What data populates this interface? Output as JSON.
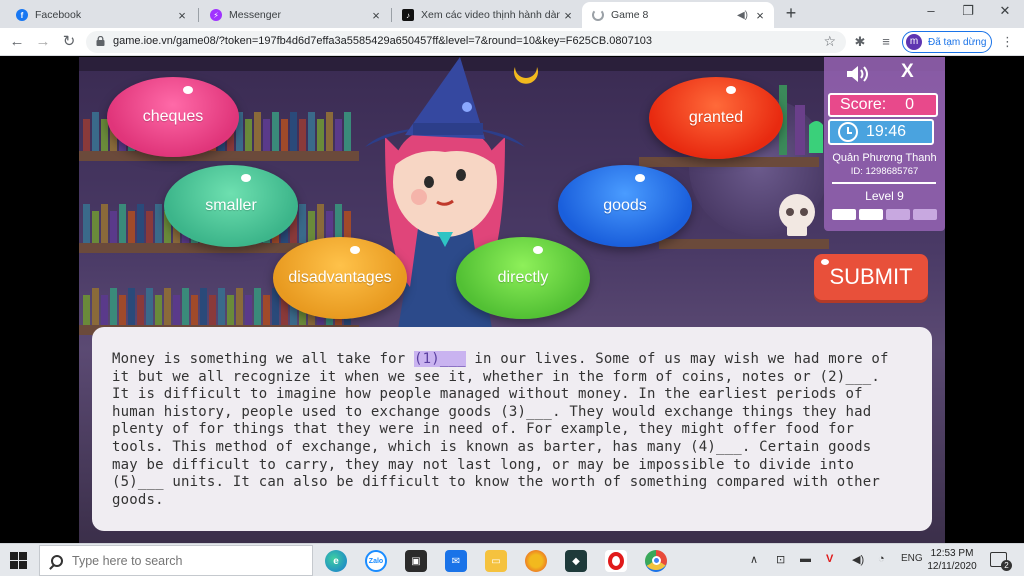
{
  "browser": {
    "tabs": [
      {
        "title": "Facebook",
        "icon": "facebook-icon",
        "color": "#1877f2",
        "glyph": "f"
      },
      {
        "title": "Messenger",
        "icon": "messenger-icon",
        "color": "#a033ff",
        "glyph": ""
      },
      {
        "title": "Xem các video thịnh hành dành cho",
        "icon": "tiktok-icon",
        "color": "#111111",
        "glyph": "♪"
      },
      {
        "title": "Game 8",
        "icon": "loading-icon",
        "color": "#9aa0a6",
        "glyph": ""
      }
    ],
    "url": "game.ioe.vn/game08/?token=197fb4d6d7effa3a5585429a650457ff&level=7&round=10&key=F625CB.0807103",
    "profile_initial": "m",
    "profile_label": "Đã tạm dừng"
  },
  "game": {
    "words": [
      "cheques",
      "granted",
      "smaller",
      "goods",
      "disadvantages",
      "directly"
    ],
    "score_label": "Score:",
    "score_value": "0",
    "timer": "19:46",
    "player_name": "Quản Phương Thanh",
    "player_id": "ID: 1298685767",
    "level": "Level 9",
    "close_label": "X",
    "submit_label": "SUBMIT",
    "passage_blank_1": "(1)___",
    "passage_lines": [
      "Money is something we all take for ",
      " in our lives. Some of us may wish we had more of",
      "it but we all recognize it when we see it, whether in the form of coins, notes or (2)___.",
      "It is difficult to imagine how people managed without money. In the earliest periods of",
      "human history, people used to exchange goods (3)___. They would exchange things they had",
      "plenty of for things that they were in need of. For example, they might offer food for",
      "tools. This method of exchange, which is known as barter, has many (4)___. Certain goods",
      "may be difficult to carry, they may not last long, or may be impossible to divide into",
      "(5)___ units. It can also be difficult to know the worth of something compared with other",
      "goods."
    ],
    "colors": {
      "pink": "#e8498b",
      "teal": "#4cc69a",
      "orange": "#f2a93b",
      "green": "#6ecf4a",
      "red": "#f04a2a",
      "blue": "#2f7de8",
      "submit": "#e8503a"
    }
  },
  "taskbar": {
    "search_placeholder": "Type here to search",
    "apps": [
      "edge-icon",
      "zalo-icon",
      "store-icon",
      "mail-icon",
      "explorer-icon",
      "chrome-canary-icon",
      "app-icon",
      "opera-icon",
      "chrome-icon"
    ],
    "zalo_label": "Zalo",
    "language": "ENG",
    "time": "12:53 PM",
    "date": "12/11/2020",
    "notifications": "2"
  }
}
